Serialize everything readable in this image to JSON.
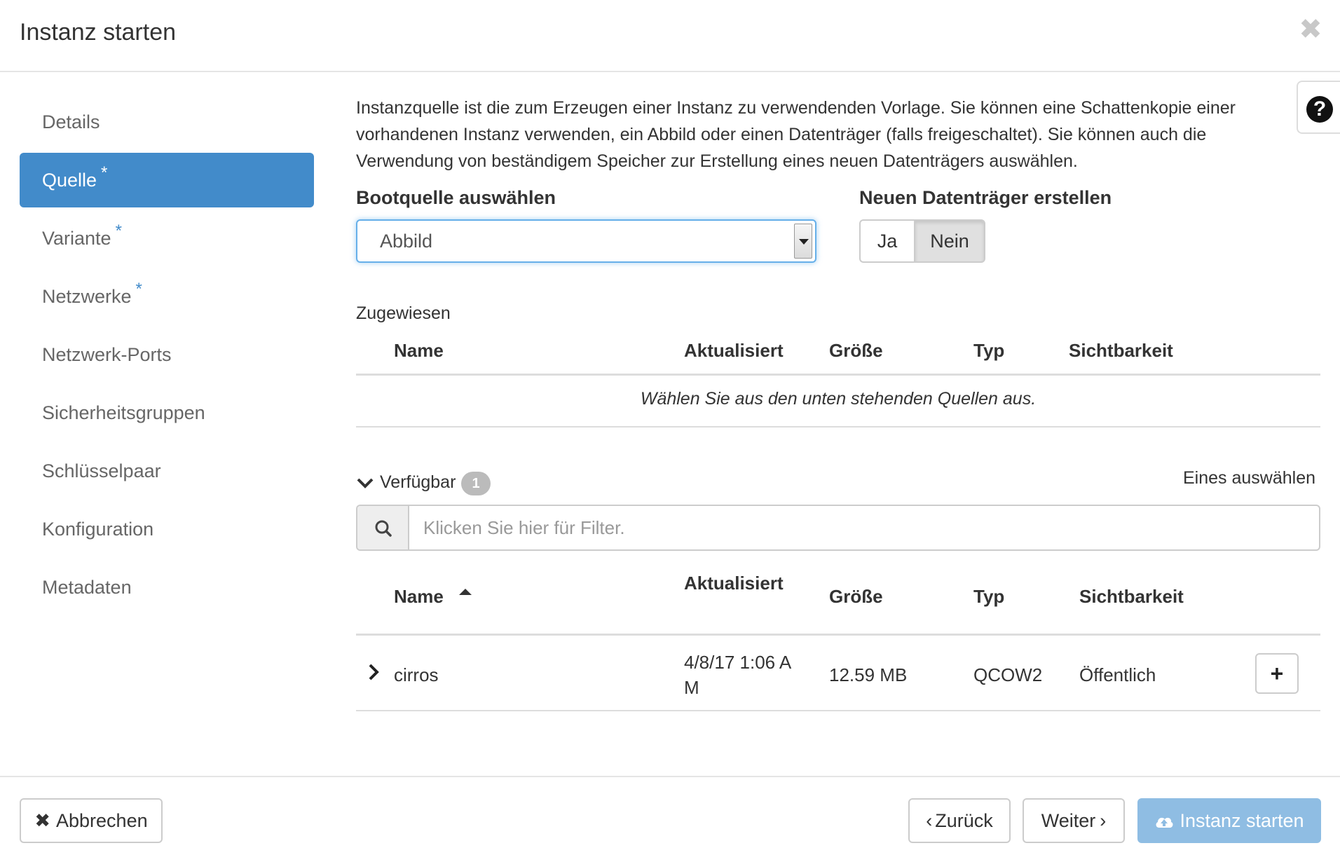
{
  "header": {
    "title": "Instanz starten",
    "close_label": "✖"
  },
  "sidebar": {
    "items": [
      {
        "label": "Details",
        "required": false,
        "active": false
      },
      {
        "label": "Quelle",
        "required": true,
        "active": true
      },
      {
        "label": "Variante",
        "required": true,
        "active": false
      },
      {
        "label": "Netzwerke",
        "required": true,
        "active": false
      },
      {
        "label": "Netzwerk-Ports",
        "required": false,
        "active": false
      },
      {
        "label": "Sicherheitsgruppen",
        "required": false,
        "active": false
      },
      {
        "label": "Schlüsselpaar",
        "required": false,
        "active": false
      },
      {
        "label": "Konfiguration",
        "required": false,
        "active": false
      },
      {
        "label": "Metadaten",
        "required": false,
        "active": false
      }
    ],
    "required_marker": "*"
  },
  "help": {
    "icon": "question-circle-icon",
    "label": "?"
  },
  "intro": "Instanzquelle ist die zum Erzeugen einer Instanz zu verwendenden Vorlage. Sie können eine Schattenkopie einer vorhandenen Instanz verwenden, ein Abbild oder einen Datenträger (falls freigeschaltet). Sie können auch die Verwendung von beständigem Speicher zur Erstellung eines neuen Datenträgers auswählen.",
  "boot_source": {
    "label": "Bootquelle auswählen",
    "value": "Abbild"
  },
  "new_volume": {
    "label": "Neuen Datenträger erstellen",
    "options": [
      "Ja",
      "Nein"
    ],
    "selected": "Nein"
  },
  "allocated": {
    "label": "Zugewiesen",
    "columns": [
      "Name",
      "Aktualisiert",
      "Größe",
      "Typ",
      "Sichtbarkeit"
    ],
    "empty_message": "Wählen Sie aus den unten stehenden Quellen aus."
  },
  "available": {
    "label": "Verfügbar",
    "count": "1",
    "select_hint": "Eines auswählen",
    "filter_placeholder": "Klicken Sie hier für Filter.",
    "columns": [
      "Name",
      "Aktualisiert",
      "Größe",
      "Typ",
      "Sichtbarkeit"
    ],
    "sort_column": "Name",
    "rows": [
      {
        "name": "cirros",
        "updated_line1": "4/8/17 1:06 A",
        "updated_line2": "M",
        "size": "12.59 MB",
        "type": "QCOW2",
        "visibility": "Öffentlich",
        "add_label": "+"
      }
    ]
  },
  "footer": {
    "cancel_label": "Abbrechen",
    "back_label": "Zurück",
    "next_label": "Weiter",
    "launch_label": "Instanz starten"
  },
  "colors": {
    "primary": "#428bca",
    "primary_disabled": "#8fbde3",
    "focus": "#66afe9"
  }
}
